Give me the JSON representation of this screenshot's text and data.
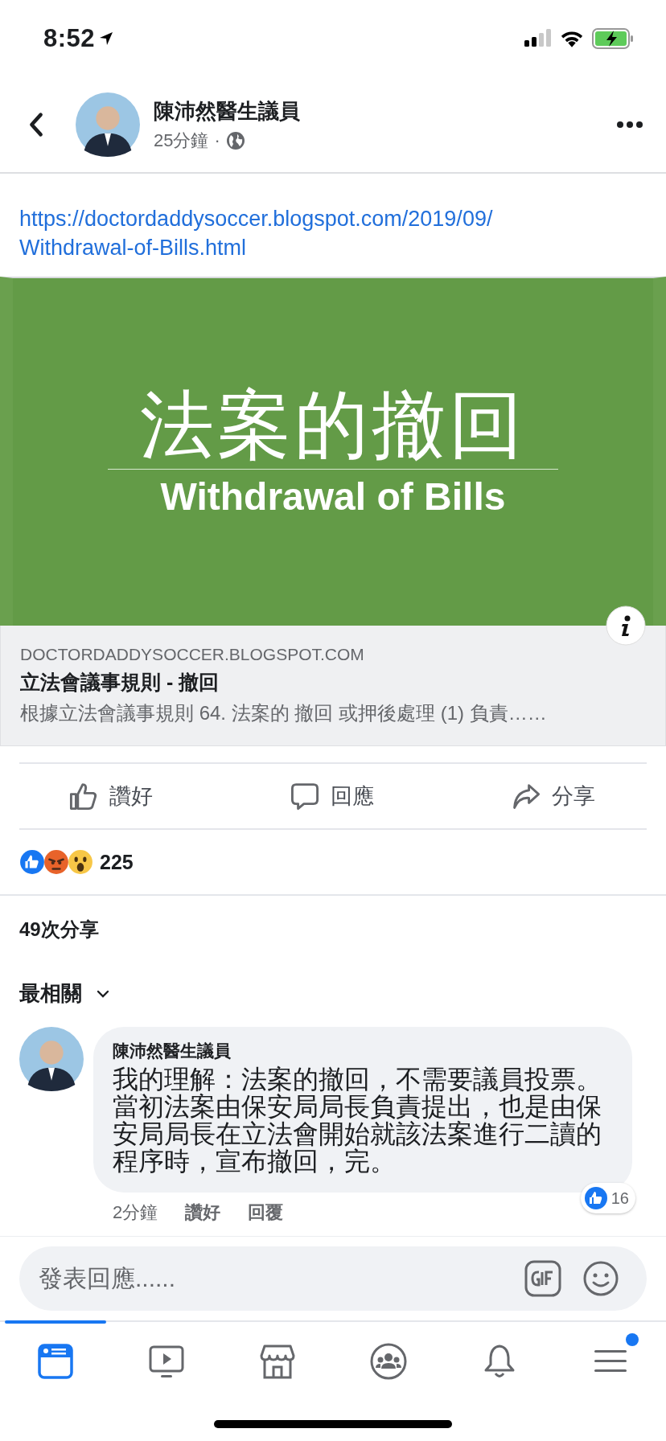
{
  "status_bar": {
    "time": "8:52"
  },
  "post_header": {
    "author": "陳沛然醫生議員",
    "time": "25分鐘",
    "separator": "·"
  },
  "post": {
    "link_url": "https://doctordaddysoccer.blogspot.com/2019/09/Withdrawal-of-Bills.html"
  },
  "link_preview": {
    "image_title": "法案的撤回",
    "image_subtitle": "Withdrawal of Bills",
    "domain": "DOCTORDADDYSOCCER.BLOGSPOT.COM",
    "title": "立法會議事規則 - 撤回",
    "description": "根據立法會議事規則 64. 法案的 撤回 或押後處理 (1) 負責……"
  },
  "actions": [
    {
      "kind": "like",
      "label": "讚好"
    },
    {
      "kind": "comment",
      "label": "回應"
    },
    {
      "kind": "share",
      "label": "分享"
    }
  ],
  "reactions": {
    "types": [
      {
        "kind": "like"
      },
      {
        "kind": "angry"
      },
      {
        "kind": "wow"
      }
    ],
    "count": "225"
  },
  "shares": "49次分享",
  "comment_sort": {
    "label": "最相關"
  },
  "comments": [
    {
      "author": "陳沛然醫生議員",
      "text": "我的理解：法案的撤回，不需要議員投票。當初法案由保安局局長負責提出，也是由保安局局長在立法會開始就該法案進行二讀的程序時，宣布撤回，完。",
      "time": "2分鐘",
      "like_label": "讚好",
      "reply_label": "回覆",
      "like_count": "16"
    }
  ],
  "comment_input": {
    "placeholder": "發表回應......"
  },
  "tab_bar": [
    {
      "kind": "feed",
      "selected": true,
      "notification_dot": false
    },
    {
      "kind": "watch",
      "selected": false,
      "notification_dot": false
    },
    {
      "kind": "marketplace",
      "selected": false,
      "notification_dot": false
    },
    {
      "kind": "groups",
      "selected": false,
      "notification_dot": false
    },
    {
      "kind": "notifications",
      "selected": false,
      "notification_dot": false
    },
    {
      "kind": "menu",
      "selected": false,
      "notification_dot": true
    }
  ]
}
